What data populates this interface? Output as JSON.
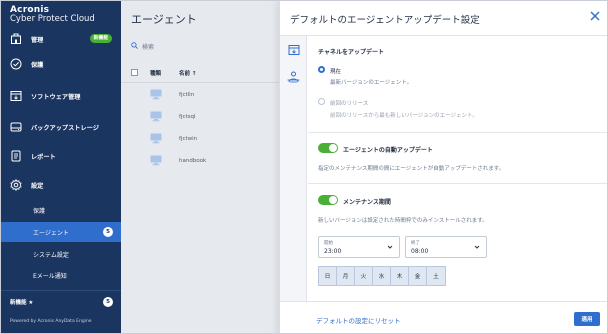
{
  "sidebar": {
    "brand_line1": "Acronis",
    "brand_line2": "Cyber Protect Cloud",
    "items": [
      {
        "label": "管理",
        "icon": "building-icon",
        "badge": "新機能"
      },
      {
        "label": "保護",
        "icon": "shield-icon"
      },
      {
        "label": "ソフトウェア管理",
        "icon": "software-icon"
      },
      {
        "label": "バックアップストレージ",
        "icon": "storage-icon"
      },
      {
        "label": "レポート",
        "icon": "report-icon"
      },
      {
        "label": "設定",
        "icon": "gear-icon"
      }
    ],
    "subitems": [
      {
        "label": "保護",
        "active": false
      },
      {
        "label": "エージェント",
        "active": true,
        "count": "5"
      },
      {
        "label": "システム設定",
        "active": false
      },
      {
        "label": "Eメール通知",
        "active": false
      }
    ],
    "whats_new_label": "新機能 ★",
    "whats_new_count": "5",
    "footer": "Powered by Acronis AnyData Engine"
  },
  "agents": {
    "title": "エージェント",
    "search_placeholder": "検索",
    "col_type": "種類",
    "col_name": "名前 ↑",
    "rows": [
      {
        "name": "fjctlin"
      },
      {
        "name": "fjctsql"
      },
      {
        "name": "fjctwin"
      },
      {
        "name": "handbook"
      }
    ]
  },
  "dialog": {
    "title": "デフォルトのエージェントアップデート設定",
    "channel_title": "チャネルをアップデート",
    "current_label": "現在",
    "current_desc": "最新バージョンのエージェント。",
    "previous_label": "前回のリリース",
    "previous_desc": "前回のリリースから最も新しいバージョンのエージェント。",
    "auto_update_label": "エージェントの自動アップデート",
    "auto_update_desc": "指定のメンテナンス期間の間にエージェントが自動アップデートされます。",
    "maintenance_label": "メンテナンス期間",
    "maintenance_desc": "新しいバージョンは設定された時間枠でのみインストールされます。",
    "start_label": "開始",
    "start_value": "23:00",
    "end_label": "終了",
    "end_value": "08:00",
    "days": [
      "日",
      "月",
      "火",
      "水",
      "木",
      "金",
      "土"
    ],
    "reset_label": "デフォルトの設定にリセット",
    "apply_label": "適用"
  },
  "colors": {
    "sidebar_bg": "#1b3561",
    "accent": "#2f6ecd",
    "toggle_on": "#4ab035"
  }
}
